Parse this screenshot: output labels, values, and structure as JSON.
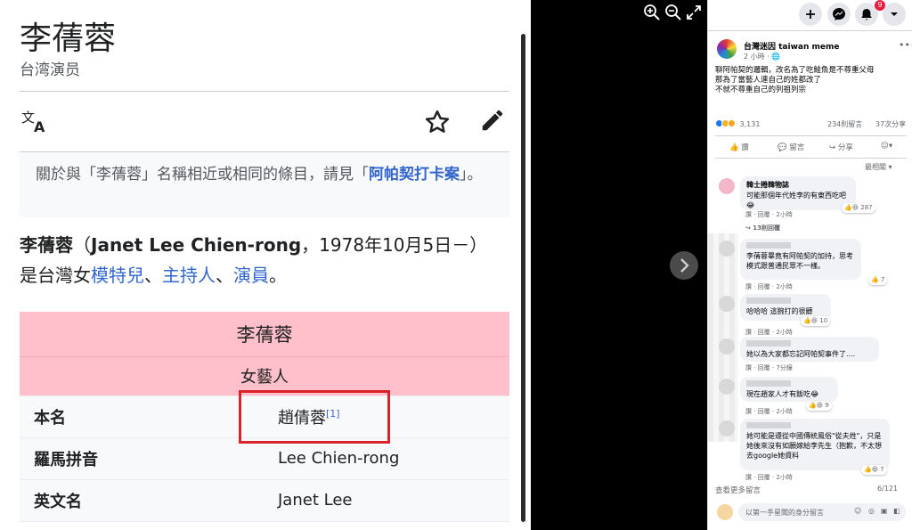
{
  "wiki": {
    "title": "李蒨蓉",
    "description": "台湾演员",
    "hatnote_prefix": "關於與「李蒨蓉」名稱相近或相同的條目，請見「",
    "hatnote_link": "阿帕契打卡案",
    "hatnote_suffix": "」。",
    "lead_name": "李蒨蓉",
    "lead_open": "（",
    "lead_english": "Janet Lee Chien-rong",
    "lead_dates": "，1978年10月5日－）",
    "lead_is": "是台灣女",
    "lead_link1": "模特兒",
    "lead_sep1": "、",
    "lead_link2": "主持人",
    "lead_sep2": "、",
    "lead_link3": "演員",
    "lead_end": "。",
    "infobox": {
      "header": "李蒨蓉",
      "subheader": "女藝人",
      "rows": [
        {
          "label": "本名",
          "value": "趙倩蓉",
          "ref": "[1]"
        },
        {
          "label": "羅馬拼音",
          "value": "Lee Chien-rong"
        },
        {
          "label": "英文名",
          "value": "Janet Lee"
        }
      ]
    }
  },
  "fb": {
    "notification_count": "9",
    "page_name": "台灣迷因 taiwan meme",
    "post_time": "2 小時 · ",
    "post_lines": [
      "聊阿帕契的邏輯，改名為了吃鮭魚是不尊重父母",
      "那為了當藝人連自己的姓都改了",
      "不就不尊重自己的列祖列宗"
    ],
    "reaction_count": "3,131",
    "comments_count": "234則留言",
    "shares_count": "37次分享",
    "actions": {
      "like": "讚",
      "comment": "留言",
      "share": "分享"
    },
    "sort": "最相關 ▾",
    "comments": [
      {
        "name": "韓士捲韓物誌",
        "text": "可能那個年代姓李的有東西吃吧😂",
        "meta": "讚 · 回覆 · 2小時",
        "reactions": "287"
      },
      {
        "name": "",
        "text": "李蒨蓉畢竟有阿帕契的加持，思考模式跟普通民眾不一樣。",
        "meta": "讚 · 回覆 · 2小時",
        "reactions": "7"
      },
      {
        "name": "",
        "text": "哈哈哈 這腕打的很髒",
        "meta": "讚 · 回覆 · 2小時",
        "reactions": "10"
      },
      {
        "name": "",
        "text": "她以為大家都忘記阿帕契事件了....",
        "meta": "讚 · 回覆 · 7分鐘",
        "reactions": ""
      },
      {
        "name": "",
        "text": "現在趙家人才有飯吃😂",
        "meta": "讚 · 回覆 · 2小時",
        "reactions": "9"
      },
      {
        "name": "",
        "text": "她可能是遵從中國傳統風俗\"從夫姓\"，只是她後來沒有如願嫁給李先生（抱歉，不太想去google她資料",
        "meta": "讚 · 回覆 · 2小時",
        "reactions": "7"
      }
    ],
    "replies_link": "↪ 13則回覆",
    "see_more": "查看更多留言",
    "counter": "6/121",
    "write_placeholder": "以第一手星聞的身分留言"
  }
}
